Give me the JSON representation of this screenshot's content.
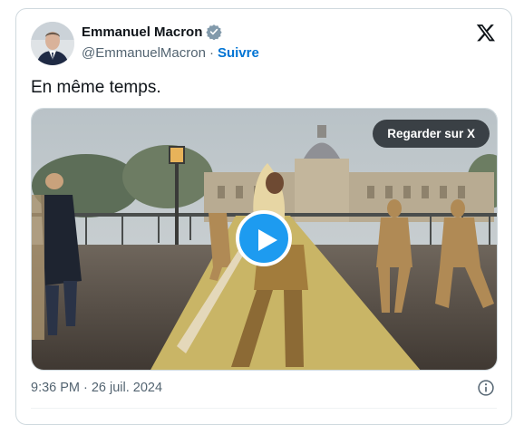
{
  "author": {
    "display_name": "Emmanuel Macron",
    "handle": "@EmmanuelMacron",
    "separator": "·",
    "follow_label": "Suivre",
    "verified_icon": "verified-badge-icon",
    "avatar_icon": "profile-photo"
  },
  "tweet": {
    "text": "En même temps."
  },
  "media": {
    "watch_label": "Regarder sur X",
    "play_icon": "play-icon",
    "golden_carpet_color": "#c9b566",
    "play_button_color": "#1d9bf0"
  },
  "footer": {
    "time": "9:36 PM",
    "separator": "·",
    "date": "26 juil. 2024",
    "info_icon": "info-icon"
  },
  "brand": {
    "logo_icon": "x-logo-icon",
    "accent_color": "#0074d4"
  }
}
